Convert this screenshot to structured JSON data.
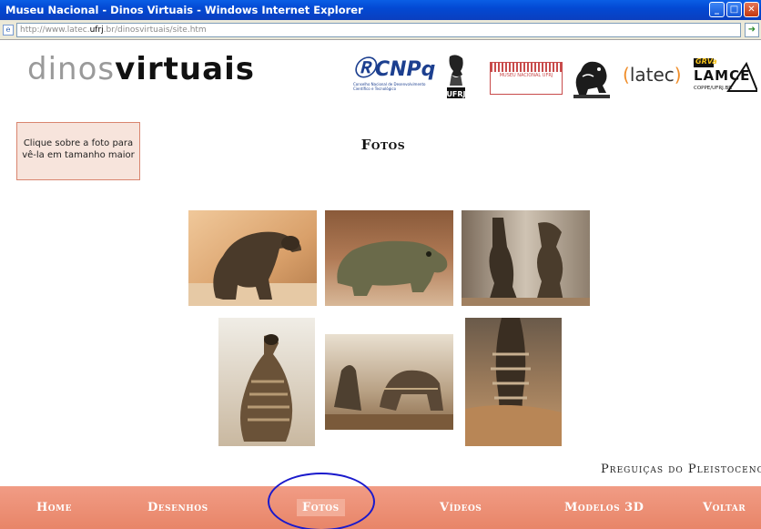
{
  "window": {
    "title": "Museu Nacional - Dinos Virtuais - Windows Internet Explorer",
    "controls": {
      "minimize": "_",
      "maximize": "□",
      "close": "✕"
    }
  },
  "address": {
    "prefix": "http://www.latec.",
    "host": "ufrj",
    "suffix": ".br/dinosvirtuais/site.htm"
  },
  "header": {
    "logo_part1": "dinos",
    "logo_part2": "virtuais",
    "partners": {
      "cnpq": "CNPq",
      "cnpq_sub": "Conselho Nacional de Desenvolvimento Científico e Tecnológico",
      "museu": "MUSEU NACIONAL  UFRJ",
      "latec": "latec",
      "lamce_top": "GRVa",
      "lamce": "LAMCE",
      "lamce_sub": "COPPE/UFRJ.BR"
    }
  },
  "info_box": {
    "text": "Clique sobre a foto para vê-la em tamanho maior"
  },
  "section": {
    "title": "Fotos"
  },
  "gallery": {
    "caption": "Preguiças do Pleistoceno"
  },
  "nav": {
    "items": [
      "Home",
      "Desenhos",
      "Fotos",
      "Vídeos",
      "Modelos 3D",
      "Voltar"
    ],
    "active": "Fotos"
  },
  "colors": {
    "nav_bg": "#ef917a",
    "nav_active_bg": "#f3ad98",
    "info_box_bg": "#f7e4dc",
    "highlight_circle": "#1a1acc"
  }
}
